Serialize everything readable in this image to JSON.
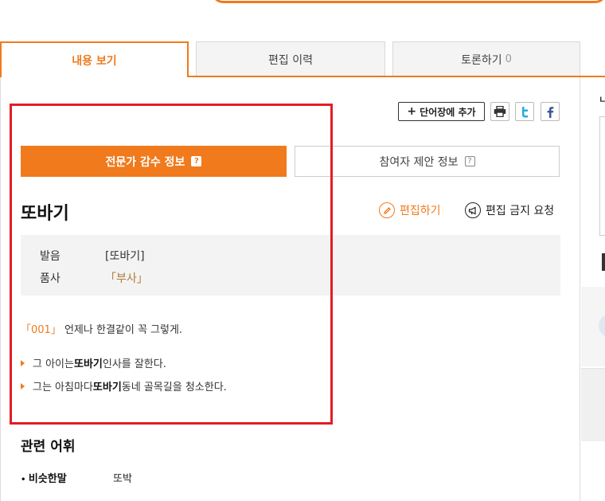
{
  "tabs": [
    {
      "label": "내용 보기",
      "active": true
    },
    {
      "label": "편집 이력",
      "active": false
    },
    {
      "label": "토론하기",
      "count": "0",
      "active": false
    }
  ],
  "actions": {
    "wordbook_label": "단어장에 추가",
    "plus": "+",
    "print_icon": "print-icon",
    "twitter_icon": "twitter-icon",
    "facebook_icon": "facebook-icon"
  },
  "subtabs": {
    "expert": "전문가 감수 정보",
    "participant": "참여자 제안 정보",
    "help_glyph": "?"
  },
  "entry": {
    "headword": "또바기",
    "edit_label": "편집하기",
    "ban_label": "편집 금지 요청",
    "pronunciation_key": "발음",
    "pronunciation_value": "[또바기]",
    "pos_key": "품사",
    "pos_value": "「부사」",
    "def_num": "「001」",
    "definition": "언제나 한결같이 꼭 그렇게.",
    "examples": [
      {
        "pre": "그 아이는 ",
        "bold": "또바기",
        "post": " 인사를 잘한다."
      },
      {
        "pre": "그는 아침마다 ",
        "bold": "또바기",
        "post": " 동네 골목길을 청소한다."
      }
    ]
  },
  "related": {
    "title": "관련 어휘",
    "synonym_key": "비슷한말",
    "synonym_value": "또박"
  },
  "colors": {
    "accent": "#f07a1c",
    "highlight": "#e21d24",
    "pos": "#b07a3a"
  }
}
